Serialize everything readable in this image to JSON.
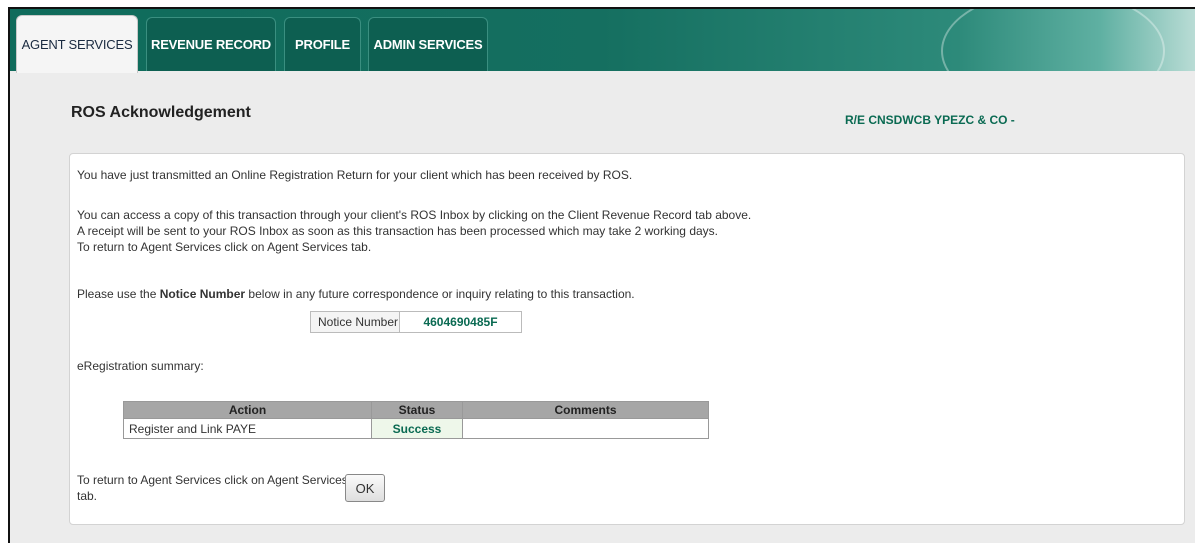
{
  "nav": {
    "tabs": [
      {
        "label": "AGENT SERVICES"
      },
      {
        "label": "REVENUE RECORD"
      },
      {
        "label": "PROFILE"
      },
      {
        "label": "ADMIN SERVICES"
      }
    ]
  },
  "header": {
    "title": "ROS Acknowledgement",
    "client": "R/E CNSDWCB YPEZC & CO -"
  },
  "message": {
    "line1": "You have just transmitted an Online Registration Return for your client which has been received by ROS.",
    "line2": "You can access a copy of this transaction through your client's ROS Inbox by clicking on the Client Revenue Record tab above.",
    "line3": "A receipt will be sent to your ROS Inbox as soon as this transaction has been processed which may take 2 working days.",
    "line4": "To return to Agent Services click on Agent Services tab.",
    "notice_prefix": "Please use the ",
    "notice_bold": "Notice Number",
    "notice_suffix": " below in any future correspondence or inquiry relating to this transaction."
  },
  "notice": {
    "label": "Notice Number",
    "value": "4604690485F"
  },
  "summary": {
    "label": "eRegistration summary:",
    "headers": [
      "Action",
      "Status",
      "Comments"
    ],
    "rows": [
      {
        "action": "Register and Link PAYE",
        "status": "Success",
        "comments": ""
      }
    ]
  },
  "footer": {
    "text_line1": "To return to Agent Services click on Agent Services",
    "text_line2": "tab.",
    "ok_label": "OK"
  }
}
